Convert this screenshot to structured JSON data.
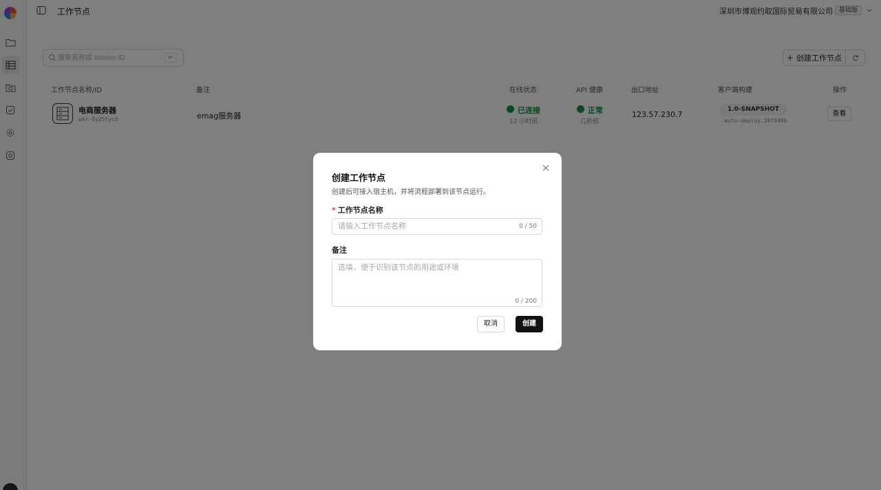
{
  "topbar": {
    "page_title": "工作节点",
    "company": "深圳市博观约取国际贸易有限公司",
    "plan_badge": "基础版"
  },
  "sidebar": {
    "items": [
      {
        "icon": "folder-icon"
      },
      {
        "icon": "table-list-icon",
        "active": true
      },
      {
        "icon": "folder-monitor-icon"
      },
      {
        "icon": "inbox-check-icon"
      },
      {
        "icon": "gear-icon"
      },
      {
        "icon": "bug-icon"
      }
    ]
  },
  "toolbar": {
    "search_placeholder": "搜索名称或 Worker ID",
    "enter_key": "↵",
    "create_label": "创建工作节点"
  },
  "table": {
    "headers": [
      "工作节点名称/ID",
      "备注",
      "在线状态",
      "API 健康",
      "出口地址",
      "客户端构建",
      "操作"
    ],
    "rows": [
      {
        "name": "电商服务器",
        "id": "wkr-8y25tyc6",
        "note": "emag服务器",
        "online_status": "已连接",
        "online_time": "12 小时前",
        "api_health": "正常",
        "api_time": "几秒前",
        "egress_ip": "123.57.230.7",
        "build_version": "1.0-SNAPSHOT",
        "build_tag": "auto-deploy.39f040b",
        "action": "查看"
      }
    ]
  },
  "modal": {
    "title": "创建工作节点",
    "description": "创建后可接入宿主机，并将流程部署到该节点运行。",
    "name_label": "工作节点名称",
    "name_required_mark": "*",
    "name_placeholder": "请输入工作节点名称",
    "name_value": "",
    "name_count": "0 / 50",
    "note_label": "备注",
    "note_placeholder": "选填，便于识别该节点的用途或环境",
    "note_value": "",
    "note_count": "0 / 200",
    "cancel_label": "取消",
    "submit_label": "创建"
  },
  "colors": {
    "success": "#1c8c4a",
    "primary_button": "#111111",
    "required": "#e03b3b"
  }
}
